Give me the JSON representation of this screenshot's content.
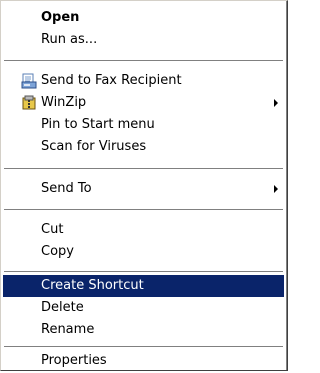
{
  "context_menu": {
    "items": [
      {
        "label": "Open"
      },
      {
        "label": "Run as..."
      },
      {
        "label": "Send to Fax Recipient",
        "icon": "fax-icon"
      },
      {
        "label": "WinZip",
        "icon": "winzip-icon",
        "submenu": true
      },
      {
        "label": "Pin to Start menu"
      },
      {
        "label": "Scan for Viruses"
      },
      {
        "label": "Send To",
        "submenu": true
      },
      {
        "label": "Cut"
      },
      {
        "label": "Copy"
      },
      {
        "label": "Create Shortcut",
        "selected": true
      },
      {
        "label": "Delete"
      },
      {
        "label": "Rename"
      },
      {
        "label": "Properties"
      }
    ],
    "colors": {
      "highlight": "#0a246a",
      "highlight_text": "#ffffff",
      "text": "#000000",
      "background": "#ffffff"
    }
  }
}
